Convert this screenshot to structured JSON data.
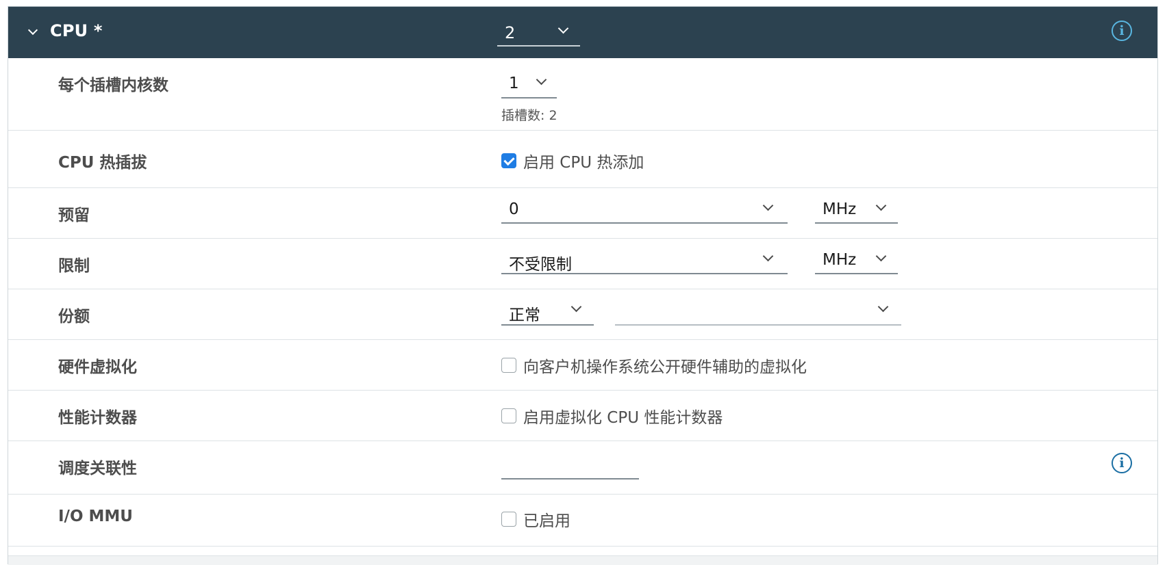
{
  "header": {
    "title": "CPU *",
    "cpu_count": "2"
  },
  "cores_per_socket": {
    "label": "每个插槽内核数",
    "value": "1",
    "helper": "插槽数: 2"
  },
  "cpu_hot_plug": {
    "label": "CPU 热插拔",
    "checkbox_label": "启用 CPU 热添加",
    "checked": true
  },
  "reservation": {
    "label": "预留",
    "value": "0",
    "unit": "MHz"
  },
  "limit": {
    "label": "限制",
    "value": "不受限制",
    "unit": "MHz"
  },
  "shares": {
    "label": "份额",
    "level": "正常",
    "value": ""
  },
  "hardware_virtualization": {
    "label": "硬件虚拟化",
    "checkbox_label": "向客户机操作系统公开硬件辅助的虚拟化",
    "checked": false
  },
  "performance_counters": {
    "label": "性能计数器",
    "checkbox_label": "启用虚拟化 CPU 性能计数器",
    "checked": false
  },
  "scheduling_affinity": {
    "label": "调度关联性",
    "value": ""
  },
  "io_mmu": {
    "label": "I/O MMU",
    "checkbox_label": "已启用",
    "checked": false
  },
  "colors": {
    "header_bg": "#2c4250",
    "accent": "#1f7de4",
    "info_header": "#59b6e0",
    "info_body": "#1a6ea3"
  },
  "icons": {
    "collapse": "chevron-down-icon",
    "info": "info-icon",
    "dropdown": "chevron-down-icon",
    "checkbox": "check-icon"
  }
}
